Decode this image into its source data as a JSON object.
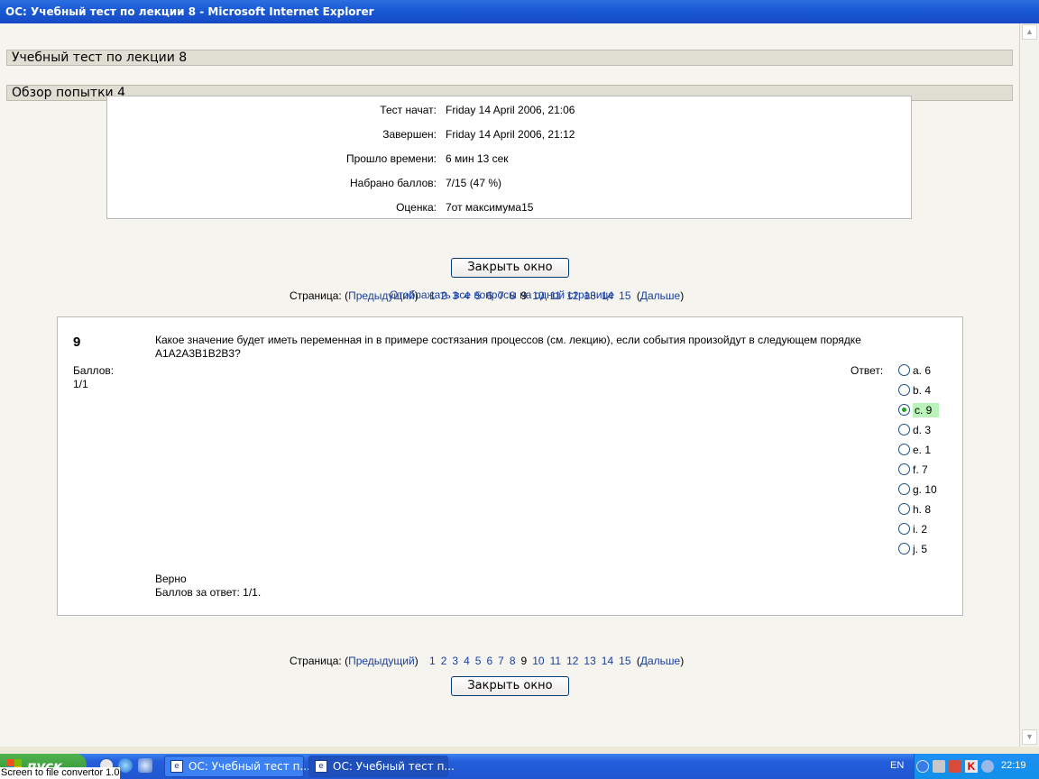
{
  "window": {
    "title": "ОС: Учебный тест по лекции 8 - Microsoft Internet Explorer"
  },
  "page": {
    "heading1": "Учебный тест по лекции 8",
    "heading2": "Обзор попытки 4"
  },
  "summary": [
    {
      "label": "Тест начат:",
      "value": "Friday 14 April 2006, 21:06"
    },
    {
      "label": "Завершен:",
      "value": "Friday 14 April 2006, 21:12"
    },
    {
      "label": "Прошло времени:",
      "value": "6 мин 13 сек"
    },
    {
      "label": "Набрано баллов:",
      "value": "7/15 (47 %)"
    },
    {
      "label": "Оценка:",
      "value": "7от максимума15"
    }
  ],
  "close_button": "Закрыть окно",
  "pager": {
    "label": "Страница:",
    "open": "(",
    "prev": "Предыдущий",
    "close": ")",
    "next": "Дальше",
    "pages": [
      "1",
      "2",
      "3",
      "4",
      "5",
      "6",
      "7",
      "8",
      "9",
      "10",
      "11",
      "12",
      "13",
      "14",
      "15"
    ],
    "current": "9"
  },
  "show_all": "Отображать все вопросы на одной странице",
  "question": {
    "number": "9",
    "grade_label": "Баллов:",
    "grade_value": "1/1",
    "text": "Какое значение будет иметь переменная in в примере состязания процессов (см. лекцию), если события произойдут в следующем порядке A1A2A3B1B2B3?",
    "answer_label": "Ответ:",
    "options": [
      "a. 6",
      "b. 4",
      "c. 9",
      "d. 3",
      "e. 1",
      "f. 7",
      "g. 10",
      "h. 8",
      "i. 2",
      "j. 5"
    ],
    "selected": 2,
    "verdict": "Верно",
    "score": "Баллов за ответ: 1/1."
  },
  "taskbar": {
    "start": "пуск",
    "converter_label": "Screen to file convertor 1.0",
    "tasks": [
      "ОС: Учебный тест п...",
      "ОС: Учебный тест п..."
    ],
    "lang": "EN",
    "clock": "22:19"
  }
}
